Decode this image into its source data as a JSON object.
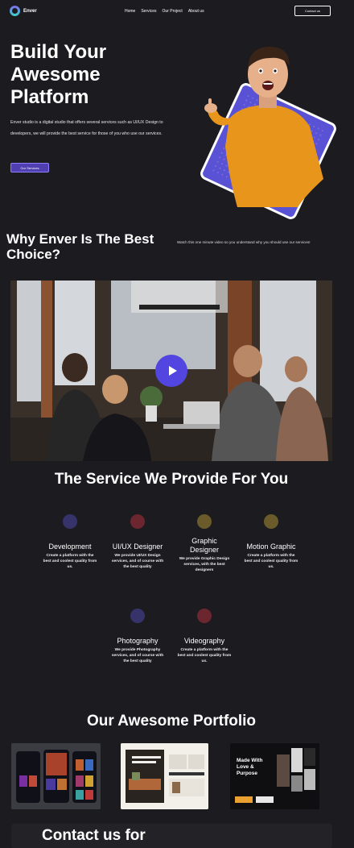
{
  "nav": {
    "brand": "Enver",
    "links": [
      "Home",
      "Services",
      "Our Project",
      "About us"
    ],
    "contact_button": "Contact us"
  },
  "hero": {
    "title": "Build Your Awesome Platform",
    "description": "Enver studio is a digital studio that offers several services such as UI/UX Design to developers, we will provide the best service for those of you who use our services.",
    "button": "Our Services"
  },
  "why": {
    "title": "Why Enver Is The Best Choice?",
    "subtitle": "Watch this one minute video so you understand why you should use our services!"
  },
  "services": {
    "title": "The Service We Provide For You",
    "items": [
      {
        "name": "Development",
        "desc": "Create a platform with the best and coolest quality from us.",
        "color": "#35336a"
      },
      {
        "name": "UI/UX Designer",
        "desc": "We provide UI/UX Design services, and of course with the best quality",
        "color": "#6b2630"
      },
      {
        "name": "Graphic Designer",
        "desc": "We provide Graphic Design services, with the best designers",
        "color": "#6b5b2a"
      },
      {
        "name": "Motion Graphic",
        "desc": "Create a platform with the best and coolest quality from us.",
        "color": "#6b5b2a"
      },
      {
        "name": "Photography",
        "desc": "We provide Photography services, and of course with the best quality",
        "color": "#35336a"
      },
      {
        "name": "Videography",
        "desc": "Create a platform with the best and coolest quality from us.",
        "color": "#6b2630"
      }
    ]
  },
  "portfolio": {
    "title": "Our Awesome Portfolio",
    "thumb_texts": [
      "Made With Love & Purpose"
    ]
  },
  "contact": {
    "title": "Contact us for"
  }
}
